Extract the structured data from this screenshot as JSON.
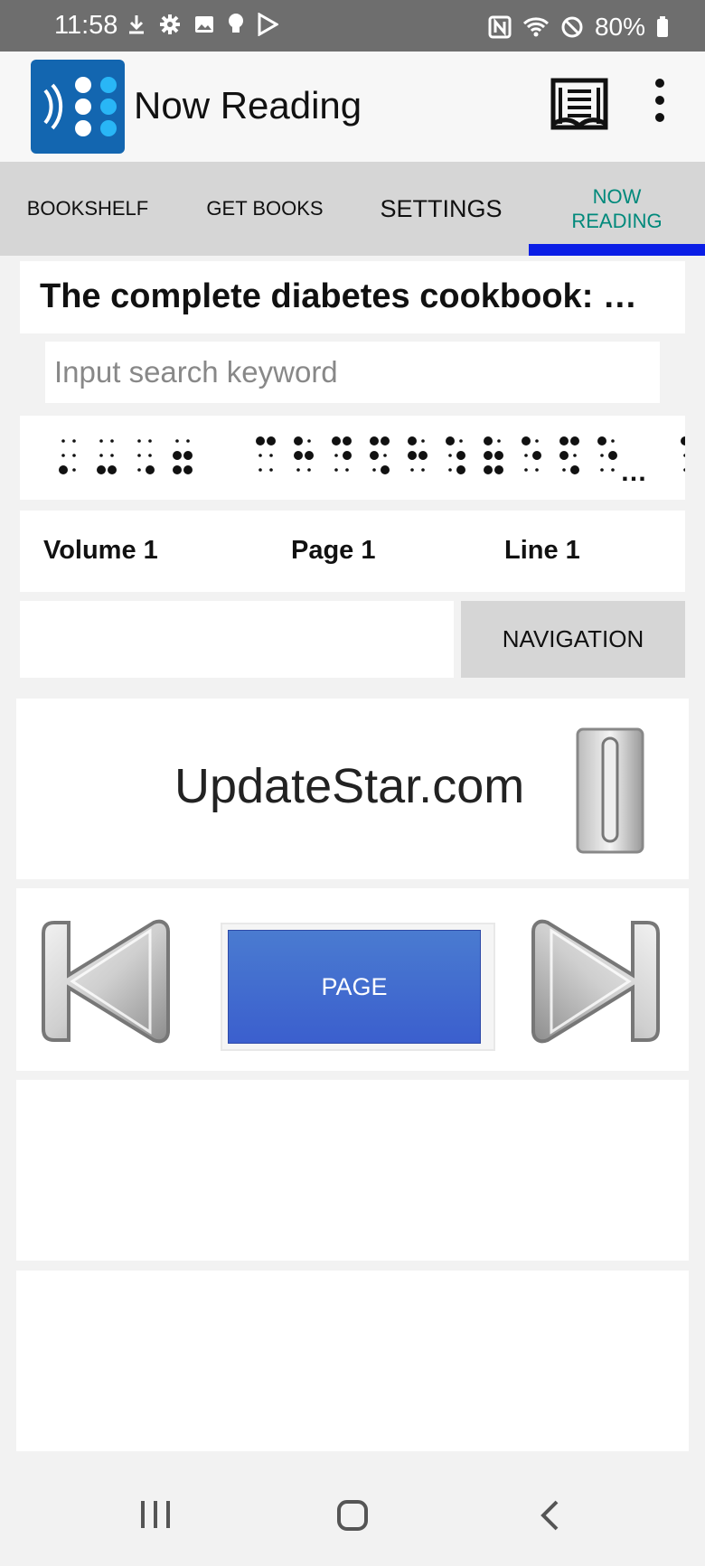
{
  "status_bar": {
    "time": "11:58",
    "battery": "80%",
    "left_icons": [
      "download-icon",
      "gear-icon",
      "image-icon",
      "bulb-icon",
      "play-store-icon"
    ],
    "right_icons": [
      "nfc-icon",
      "wifi-icon",
      "do-not-disturb-icon",
      "battery-icon"
    ]
  },
  "app_bar": {
    "title": "Now Reading",
    "logo": "braille-app-logo",
    "book_button": "book-list-icon",
    "menu_button": "overflow-menu-icon"
  },
  "tabs": [
    {
      "label": "BOOKSHELF",
      "selected": false
    },
    {
      "label": "GET BOOKS",
      "selected": false
    },
    {
      "label": "SETTINGS",
      "selected": false
    },
    {
      "label": "NOW\nREADING",
      "selected": true
    }
  ],
  "book": {
    "title": "The complete diabetes cookbook: …"
  },
  "search": {
    "placeholder": "Input search keyword",
    "value": ""
  },
  "braille_line": {
    "ellipsis": "…"
  },
  "location": {
    "volume": "Volume 1",
    "page": "Page 1",
    "line": "Line 1"
  },
  "navigation": {
    "button_label": "NAVIGATION",
    "field_value": ""
  },
  "ad": {
    "text": "UpdateStar.com"
  },
  "controls": {
    "page_label": "PAGE",
    "prev_icon": "previous-icon",
    "next_icon": "next-icon"
  },
  "colors": {
    "accent": "#00897b",
    "tab_indicator": "#0a1ee6",
    "logo_bg": "#1366b0",
    "page_button": "#3f67cf"
  }
}
